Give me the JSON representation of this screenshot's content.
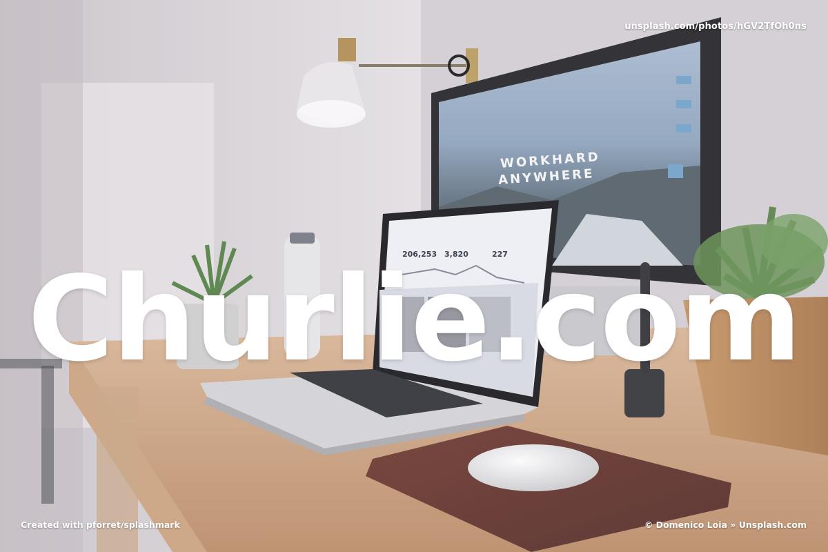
{
  "photo": {
    "subject": "desk-workspace",
    "colors": {
      "wall": "#dcd8dc",
      "desk": "#c9a27c",
      "mousepad": "#5a2b24",
      "plant": "#5e8c4a",
      "monitor_frame": "#1c1c1f"
    }
  },
  "watermark": {
    "title": "Churlie.com",
    "source_url": "unsplash.com/photos/hGV2TfOh0ns",
    "created_with": "Created with pforret/splashmark",
    "credit": "© Domenico Loia » Unsplash.com"
  },
  "monitor_screen": {
    "line1": "WORKHARD",
    "line2": "ANYWHERE"
  },
  "laptop_screen": {
    "stats": [
      "206,253",
      "3,820",
      "227"
    ]
  }
}
